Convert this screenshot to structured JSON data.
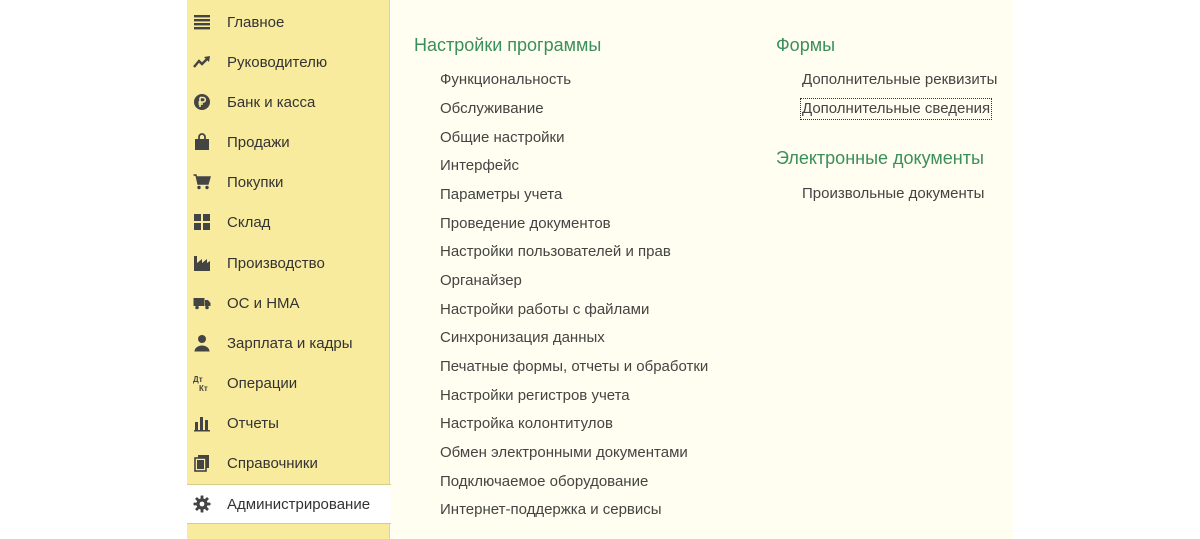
{
  "sidebar": {
    "items": [
      {
        "label": "Главное",
        "icon": "menu-lines-icon"
      },
      {
        "label": "Руководителю",
        "icon": "trend-up-icon"
      },
      {
        "label": "Банк и касса",
        "icon": "ruble-coin-icon"
      },
      {
        "label": "Продажи",
        "icon": "shopping-bag-icon"
      },
      {
        "label": "Покупки",
        "icon": "cart-icon"
      },
      {
        "label": "Склад",
        "icon": "warehouse-grid-icon"
      },
      {
        "label": "Производство",
        "icon": "factory-icon"
      },
      {
        "label": "ОС и НМА",
        "icon": "truck-icon"
      },
      {
        "label": "Зарплата и кадры",
        "icon": "person-icon"
      },
      {
        "label": "Операции",
        "icon": "debit-credit-icon"
      },
      {
        "label": "Отчеты",
        "icon": "bar-chart-icon"
      },
      {
        "label": "Справочники",
        "icon": "books-icon"
      },
      {
        "label": "Администрирование",
        "icon": "gear-icon"
      }
    ],
    "active_index": 12
  },
  "content": {
    "settings": {
      "title": "Настройки программы",
      "links": [
        "Функциональность",
        "Обслуживание",
        "Общие настройки",
        "Интерфейс",
        "Параметры учета",
        "Проведение документов",
        "Настройки пользователей и прав",
        "Органайзер",
        "Настройки работы с файлами",
        "Синхронизация данных",
        "Печатные формы, отчеты и обработки",
        "Настройки регистров учета",
        "Настройка колонтитулов",
        "Обмен электронными документами",
        "Подключаемое оборудование",
        "Интернет-поддержка и сервисы"
      ]
    },
    "forms": {
      "title": "Формы",
      "links": [
        "Дополнительные реквизиты",
        "Дополнительные сведения"
      ],
      "focused_index": 1
    },
    "edocs": {
      "title": "Электронные документы",
      "links": [
        "Произвольные документы"
      ]
    }
  },
  "colors": {
    "sidebar_bg": "#f8eb9d",
    "content_bg": "#fffef0",
    "section_title": "#3a8f5c"
  }
}
